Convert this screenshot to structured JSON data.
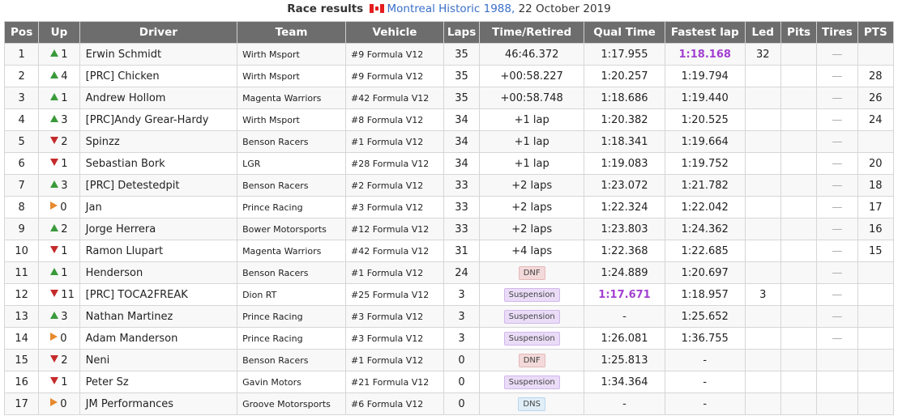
{
  "header": {
    "label": "Race results",
    "track_link": "Montreal Historic 1988,",
    "date": "22 October 2019"
  },
  "columns": [
    "Pos",
    "Up",
    "Driver",
    "Team",
    "Vehicle",
    "Laps",
    "Time/Retired",
    "Qual Time",
    "Fastest lap",
    "Led",
    "Pits",
    "Tires",
    "PTS"
  ],
  "colors": {
    "header_bg": "#6d6d6d",
    "up": "#3a9a3a",
    "down": "#c42a2a",
    "same": "#e8892d",
    "highlight": "#a23fd1"
  },
  "rows": [
    {
      "pos": "1",
      "dir": "up",
      "up": "1",
      "driver": "Erwin Schmidt",
      "team": "Wirth Msport",
      "vehicle": "#9 Formula V12",
      "laps": "35",
      "time": "46:46.372",
      "time_type": "text",
      "qual": "1:17.955",
      "qual_hl": false,
      "fast": "1:18.168",
      "fast_hl": true,
      "led": "32",
      "tires": "—",
      "pts": ""
    },
    {
      "pos": "2",
      "dir": "up",
      "up": "4",
      "driver": "[PRC] Chicken",
      "team": "Wirth Msport",
      "vehicle": "#9 Formula V12",
      "laps": "35",
      "time": "+00:58.227",
      "time_type": "text",
      "qual": "1:20.257",
      "qual_hl": false,
      "fast": "1:19.794",
      "fast_hl": false,
      "led": "",
      "tires": "—",
      "pts": "28"
    },
    {
      "pos": "3",
      "dir": "up",
      "up": "1",
      "driver": "Andrew Hollom",
      "team": "Magenta Warriors",
      "vehicle": "#42 Formula V12",
      "laps": "35",
      "time": "+00:58.748",
      "time_type": "text",
      "qual": "1:18.686",
      "qual_hl": false,
      "fast": "1:19.440",
      "fast_hl": false,
      "led": "",
      "tires": "—",
      "pts": "26"
    },
    {
      "pos": "4",
      "dir": "up",
      "up": "3",
      "driver": "[PRC]Andy Grear-Hardy",
      "team": "Wirth Msport",
      "vehicle": "#8 Formula V12",
      "laps": "34",
      "time": "+1 lap",
      "time_type": "text",
      "qual": "1:20.382",
      "qual_hl": false,
      "fast": "1:20.525",
      "fast_hl": false,
      "led": "",
      "tires": "—",
      "pts": "24"
    },
    {
      "pos": "5",
      "dir": "down",
      "up": "2",
      "driver": "Spinzz",
      "team": "Benson Racers",
      "vehicle": "#1 Formula V12",
      "laps": "34",
      "time": "+1 lap",
      "time_type": "text",
      "qual": "1:18.341",
      "qual_hl": false,
      "fast": "1:19.664",
      "fast_hl": false,
      "led": "",
      "tires": "—",
      "pts": ""
    },
    {
      "pos": "6",
      "dir": "down",
      "up": "1",
      "driver": "Sebastian Bork",
      "team": "LGR",
      "vehicle": "#28 Formula V12",
      "laps": "34",
      "time": "+1 lap",
      "time_type": "text",
      "qual": "1:19.083",
      "qual_hl": false,
      "fast": "1:19.752",
      "fast_hl": false,
      "led": "",
      "tires": "—",
      "pts": "20"
    },
    {
      "pos": "7",
      "dir": "up",
      "up": "3",
      "driver": "[PRC] Detestedpit",
      "team": "Benson Racers",
      "vehicle": "#2 Formula V12",
      "laps": "33",
      "time": "+2 laps",
      "time_type": "text",
      "qual": "1:23.072",
      "qual_hl": false,
      "fast": "1:21.782",
      "fast_hl": false,
      "led": "",
      "tires": "—",
      "pts": "18"
    },
    {
      "pos": "8",
      "dir": "same",
      "up": "0",
      "driver": "Jan",
      "team": "Prince Racing",
      "vehicle": "#3 Formula V12",
      "laps": "33",
      "time": "+2 laps",
      "time_type": "text",
      "qual": "1:22.324",
      "qual_hl": false,
      "fast": "1:22.042",
      "fast_hl": false,
      "led": "",
      "tires": "—",
      "pts": "17"
    },
    {
      "pos": "9",
      "dir": "up",
      "up": "2",
      "driver": "Jorge Herrera",
      "team": "Bower Motorsports",
      "vehicle": "#12 Formula V12",
      "laps": "33",
      "time": "+2 laps",
      "time_type": "text",
      "qual": "1:23.803",
      "qual_hl": false,
      "fast": "1:24.362",
      "fast_hl": false,
      "led": "",
      "tires": "—",
      "pts": "16"
    },
    {
      "pos": "10",
      "dir": "down",
      "up": "1",
      "driver": "Ramon Llupart",
      "team": "Magenta Warriors",
      "vehicle": "#42 Formula V12",
      "laps": "31",
      "time": "+4 laps",
      "time_type": "text",
      "qual": "1:22.368",
      "qual_hl": false,
      "fast": "1:22.685",
      "fast_hl": false,
      "led": "",
      "tires": "—",
      "pts": "15"
    },
    {
      "pos": "11",
      "dir": "up",
      "up": "1",
      "driver": "Henderson",
      "team": "Benson Racers",
      "vehicle": "#1 Formula V12",
      "laps": "24",
      "time": "DNF",
      "time_type": "dnf",
      "qual": "1:24.889",
      "qual_hl": false,
      "fast": "1:20.697",
      "fast_hl": false,
      "led": "",
      "tires": "—",
      "pts": ""
    },
    {
      "pos": "12",
      "dir": "down",
      "up": "11",
      "driver": "[PRC] TOCA2FREAK",
      "team": "Dion RT",
      "vehicle": "#25 Formula V12",
      "laps": "3",
      "time": "Suspension",
      "time_type": "susp",
      "qual": "1:17.671",
      "qual_hl": true,
      "fast": "1:18.957",
      "fast_hl": false,
      "led": "3",
      "tires": "—",
      "pts": ""
    },
    {
      "pos": "13",
      "dir": "up",
      "up": "3",
      "driver": "Nathan Martinez",
      "team": "Prince Racing",
      "vehicle": "#3 Formula V12",
      "laps": "3",
      "time": "Suspension",
      "time_type": "susp",
      "qual": "-",
      "qual_hl": false,
      "fast": "1:25.652",
      "fast_hl": false,
      "led": "",
      "tires": "—",
      "pts": ""
    },
    {
      "pos": "14",
      "dir": "same",
      "up": "0",
      "driver": "Adam Manderson",
      "team": "Prince Racing",
      "vehicle": "#3 Formula V12",
      "laps": "3",
      "time": "Suspension",
      "time_type": "susp",
      "qual": "1:26.081",
      "qual_hl": false,
      "fast": "1:36.755",
      "fast_hl": false,
      "led": "",
      "tires": "—",
      "pts": ""
    },
    {
      "pos": "15",
      "dir": "down",
      "up": "2",
      "driver": "Neni",
      "team": "Benson Racers",
      "vehicle": "#1 Formula V12",
      "laps": "0",
      "time": "DNF",
      "time_type": "dnf",
      "qual": "1:25.813",
      "qual_hl": false,
      "fast": "-",
      "fast_hl": false,
      "led": "",
      "tires": "",
      "pts": ""
    },
    {
      "pos": "16",
      "dir": "down",
      "up": "1",
      "driver": "Peter Sz",
      "team": "Gavin Motors",
      "vehicle": "#21 Formula V12",
      "laps": "0",
      "time": "Suspension",
      "time_type": "susp",
      "qual": "1:34.364",
      "qual_hl": false,
      "fast": "-",
      "fast_hl": false,
      "led": "",
      "tires": "",
      "pts": ""
    },
    {
      "pos": "17",
      "dir": "same",
      "up": "0",
      "driver": "JM Performances",
      "team": "Groove Motorsports",
      "vehicle": "#6 Formula V12",
      "laps": "0",
      "time": "DNS",
      "time_type": "dns",
      "qual": "-",
      "qual_hl": false,
      "fast": "-",
      "fast_hl": false,
      "led": "",
      "tires": "",
      "pts": ""
    }
  ]
}
